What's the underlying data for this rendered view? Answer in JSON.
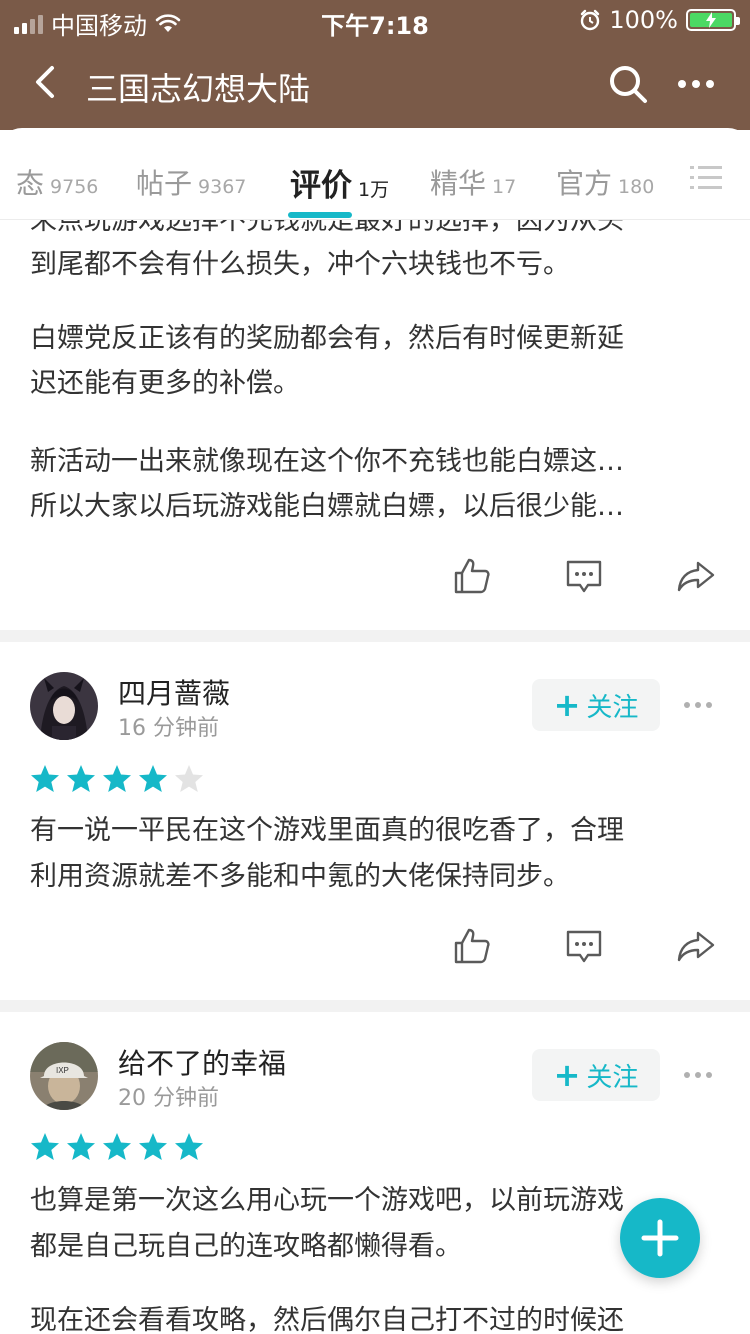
{
  "status_bar": {
    "carrier": "中国移动",
    "time": "下午7:18",
    "battery": "100%"
  },
  "navbar": {
    "title": "三国志幻想大陆"
  },
  "tabs": [
    {
      "label": "态",
      "count": "9756"
    },
    {
      "label": "帖子",
      "count": "9367"
    },
    {
      "label": "评价",
      "count": "1万",
      "active": true
    },
    {
      "label": "精华",
      "count": "17"
    },
    {
      "label": "官方",
      "count": "180"
    }
  ],
  "posts": [
    {
      "paragraphs": [
        "来点玩游戏选择不充钱就是最好的选择，因为从头",
        "到尾都不会有什么损失，冲个六块钱也不亏。",
        "白嫖党反正该有的奖励都会有，然后有时候更新延",
        "迟还能有更多的补偿。",
        "新活动一出来就像现在这个你不充钱也能白嫖这…",
        "所以大家以后玩游戏能白嫖就白嫖，以后很少能…"
      ]
    },
    {
      "user": "四月蔷薇",
      "time": "16 分钟前",
      "follow_label": "关注",
      "rating": 4,
      "paragraphs": [
        "有一说一平民在这个游戏里面真的很吃香了，合理",
        "利用资源就差不多能和中氪的大佬保持同步。"
      ]
    },
    {
      "user": "给不了的幸福",
      "time": "20 分钟前",
      "follow_label": "关注",
      "rating": 5,
      "paragraphs": [
        "也算是第一次这么用心玩一个游戏吧，以前玩游戏",
        "都是自己玩自己的连攻略都懒得看。",
        "现在还会看看攻略，然后偶尔自己打不过的时候还"
      ]
    }
  ],
  "colors": {
    "header": "#7a5a48",
    "accent": "#16b8c8",
    "star_empty": "#e3e3e3"
  },
  "icons": [
    "back-icon",
    "search-icon",
    "more-icon",
    "menu-icon",
    "like-icon",
    "comment-icon",
    "share-icon",
    "star-icon",
    "plus-icon"
  ]
}
